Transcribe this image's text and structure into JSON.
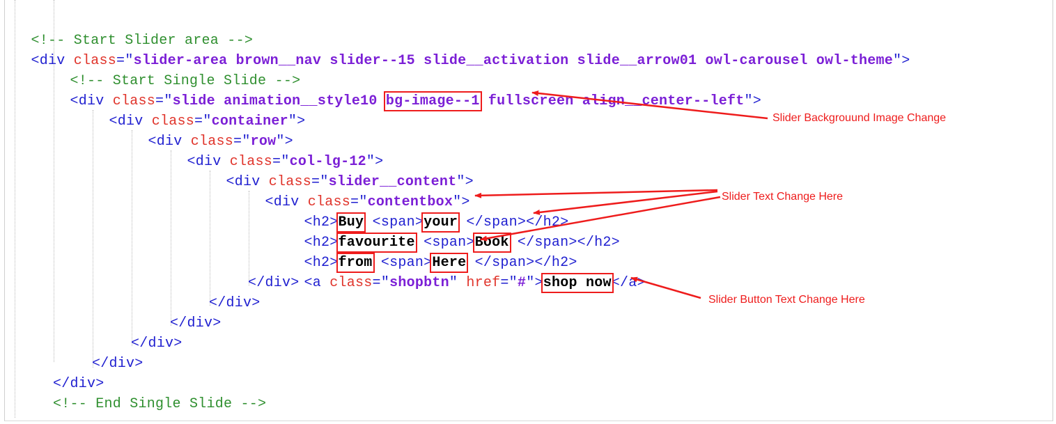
{
  "code": {
    "l01": "<!-- Start Slider area -->",
    "l02": {
      "open": "<div ",
      "attr": "class",
      "eq": "=",
      "q1": "\"",
      "value": "slider-area brown__nav slider--15 slide__activation slide__arrow01 owl-carousel owl-theme",
      "q2": "\"",
      "close": ">"
    },
    "l03": "<!-- Start Single Slide -->",
    "l04": {
      "open": "<div ",
      "attr": "class",
      "eq": "=",
      "q1": "\"",
      "value_a": "slide animation__style10 ",
      "value_hl": "bg-image--1",
      "value_b": " fullscreen align__center--left",
      "q2": "\"",
      "close": ">"
    },
    "l05": {
      "open": "<div ",
      "attr": "class",
      "eq": "=",
      "q1": "\"",
      "value": "container",
      "q2": "\"",
      "close": ">"
    },
    "l06": {
      "open": "<div ",
      "attr": "class",
      "eq": "=",
      "q1": "\"",
      "value": "row",
      "q2": "\"",
      "close": ">"
    },
    "l07": {
      "open": "<div ",
      "attr": "class",
      "eq": "=",
      "q1": "\"",
      "value": "col-lg-12",
      "q2": "\"",
      "close": ">"
    },
    "l08": {
      "open": "<div ",
      "attr": "class",
      "eq": "=",
      "q1": "\"",
      "value": "slider__content",
      "q2": "\"",
      "close": ">"
    },
    "l09": {
      "open": "<div ",
      "attr": "class",
      "eq": "=",
      "q1": "\"",
      "value": "contentbox",
      "q2": "\"",
      "close": ">"
    },
    "l10": {
      "h2open": "<h2>",
      "text1": "Buy",
      "gap": " ",
      "spanopen": "<span>",
      "text2": "your",
      "tail": " </span></h2>"
    },
    "l11": {
      "h2open": "<h2>",
      "text1": "favourite",
      "gap": " ",
      "spanopen": "<span>",
      "text2": "Book",
      "tail": " </span></h2>"
    },
    "l12": {
      "h2open": "<h2>",
      "text1": "from",
      "gap": " ",
      "spanopen": "<span>",
      "text2": "Here",
      "tail": " </span></h2>"
    },
    "l13": {
      "open": "<a ",
      "attr1": "class",
      "eq": "=",
      "q": "\"",
      "val1": "shopbtn",
      "attr2": "href",
      "val2": "#",
      "gt": ">",
      "text": "shop now",
      "close": "</a>"
    },
    "l14": "</div>",
    "l15": "</div>",
    "l16": "</div>",
    "l17": "</div>",
    "l18": "</div>",
    "l19": "</div>",
    "l20": "<!-- End Single Slide -->"
  },
  "annotations": {
    "bg_image": "Slider Backgrouund Image Change",
    "text": "Slider Text Change Here",
    "button": "Slider Button Text Change Here"
  },
  "colors": {
    "comment": "#2f8f2f",
    "tag": "#1f1fd0",
    "attribute": "#e0342b",
    "string": "#7b1fd6",
    "highlight": "#ee1c1c"
  }
}
